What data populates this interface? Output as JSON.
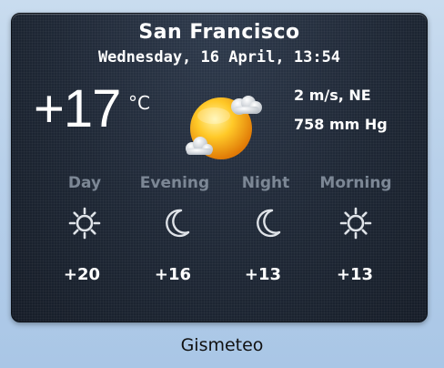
{
  "widget": {
    "city": "San Francisco",
    "datetime": "Wednesday, 16 April, 13:54",
    "current": {
      "temperature": "+17",
      "unit": "°C",
      "condition_icon": "sun-with-clouds-icon",
      "wind": "2 m/s, NE",
      "pressure": "758 mm Hg"
    },
    "forecast": [
      {
        "period": "Day",
        "icon": "sun-icon",
        "temp": "+20"
      },
      {
        "period": "Evening",
        "icon": "moon-icon",
        "temp": "+16"
      },
      {
        "period": "Night",
        "icon": "moon-icon",
        "temp": "+13"
      },
      {
        "period": "Morning",
        "icon": "sun-icon",
        "temp": "+13"
      }
    ]
  },
  "caption": "Gismeteo",
  "colors": {
    "panel": "#1f2836",
    "period_label": "#7c8795",
    "text": "#ffffff"
  }
}
